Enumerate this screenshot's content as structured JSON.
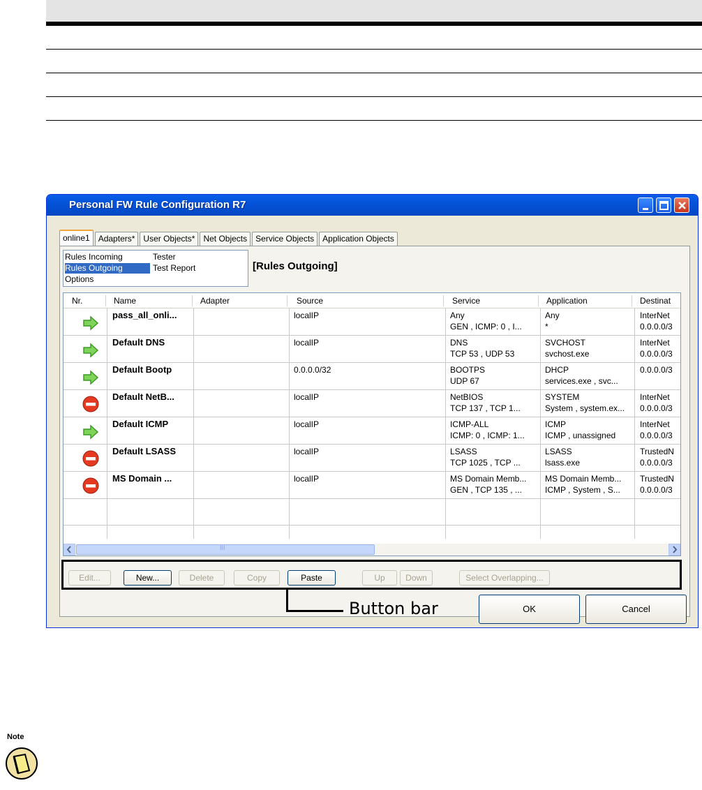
{
  "dialog": {
    "title": "Personal FW Rule Configuration R7",
    "tabs": [
      "online1",
      "Adapters*",
      "User Objects*",
      "Net Objects",
      "Service Objects",
      "Application Objects"
    ],
    "list_items": [
      "Rules Incoming",
      "Tester",
      "Rules Outgoing",
      "Test Report",
      "Options"
    ],
    "section_title": "[Rules Outgoing]",
    "columns": [
      "Nr.",
      "Name",
      "Adapter",
      "Source",
      "Service",
      "Application",
      "Destinat"
    ],
    "rows": [
      {
        "action": "allow",
        "name": "pass_all_onli...",
        "source": "localIP",
        "service": "Any",
        "service2": "GEN  , ICMP: 0 , I...",
        "app": "Any",
        "app2": "*",
        "dest": "InterNet",
        "dest2": "0.0.0.0/3"
      },
      {
        "action": "allow",
        "name": "Default DNS",
        "source": "localIP",
        "service": "DNS",
        "service2": "TCP 53 , UDP 53",
        "app": "SVCHOST",
        "app2": "svchost.exe",
        "dest": "InterNet",
        "dest2": "0.0.0.0/3"
      },
      {
        "action": "allow",
        "name": "Default Bootp",
        "source": "0.0.0.0/32",
        "service": "BOOTPS",
        "service2": "UDP 67",
        "app": "DHCP",
        "app2": "services.exe , svc...",
        "dest": "0.0.0.0/3",
        "dest2": ""
      },
      {
        "action": "deny",
        "name": "Default NetB...",
        "source": "localIP",
        "service": "NetBIOS",
        "service2": "TCP 137 , TCP 1...",
        "app": "SYSTEM",
        "app2": "System , system.ex...",
        "dest": "InterNet",
        "dest2": "0.0.0.0/3"
      },
      {
        "action": "allow",
        "name": "Default ICMP",
        "source": "localIP",
        "service": "ICMP-ALL",
        "service2": "ICMP: 0 , ICMP: 1...",
        "app": "ICMP",
        "app2": "ICMP , unassigned",
        "dest": "InterNet",
        "dest2": "0.0.0.0/3"
      },
      {
        "action": "deny",
        "name": "Default LSASS",
        "source": "localIP",
        "service": "LSASS",
        "service2": "TCP 1025 , TCP ...",
        "app": "LSASS",
        "app2": "lsass.exe",
        "dest": "TrustedN",
        "dest2": "0.0.0.0/3"
      },
      {
        "action": "deny",
        "name": "MS Domain ...",
        "source": "localIP",
        "service": "MS Domain Memb...",
        "service2": "GEN  , TCP 135 , ...",
        "app": "MS Domain Memb...",
        "app2": "ICMP , System , S...",
        "dest": "TrustedN",
        "dest2": "0.0.0.0/3"
      }
    ],
    "buttons": {
      "edit": "Edit...",
      "new": "New...",
      "delete": "Delete",
      "copy": "Copy",
      "paste": "Paste",
      "up": "Up",
      "down": "Down",
      "select_overlapping": "Select Overlapping...",
      "ok": "OK",
      "cancel": "Cancel"
    },
    "scroll_mid": "III"
  },
  "callout": "Button bar",
  "note_label": "Note",
  "icons": {
    "allow": "green-arrow-icon",
    "deny": "red-no-entry-icon",
    "note": "notepad-icon"
  }
}
